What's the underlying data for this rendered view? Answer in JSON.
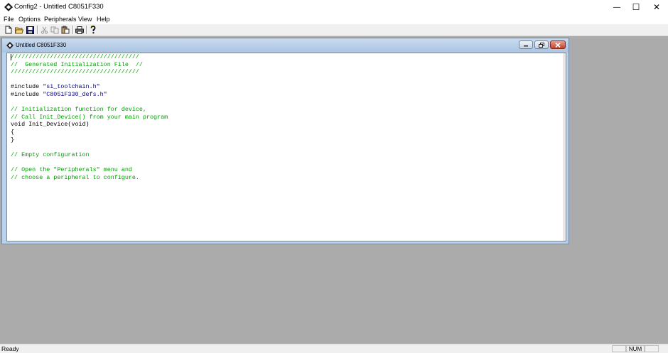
{
  "window": {
    "title": "Config2 - Untitled C8051F330",
    "controls": {
      "minimize": "—",
      "maximize": "☐",
      "close": "✕"
    }
  },
  "menu": [
    "File",
    "Options",
    "Peripherals",
    "View",
    "Help"
  ],
  "toolbar": {
    "buttons": [
      "new-file-icon",
      "open-folder-icon",
      "save-icon",
      "cut-icon",
      "copy-icon",
      "paste-icon",
      "print-icon",
      "help-icon"
    ]
  },
  "document": {
    "title": "Untitled C8051F330",
    "code_lines": [
      [
        {
          "t": "////////////////////////////////////",
          "c": "com"
        }
      ],
      [
        {
          "t": "//  Generated Initialization File  //",
          "c": "com"
        }
      ],
      [
        {
          "t": "////////////////////////////////////",
          "c": "com"
        }
      ],
      [],
      [
        {
          "t": "#include ",
          "c": "txt"
        },
        {
          "t": "\"si_toolchain.h\"",
          "c": "str"
        }
      ],
      [
        {
          "t": "#include ",
          "c": "txt"
        },
        {
          "t": "\"C8051F330_defs.h\"",
          "c": "str"
        }
      ],
      [],
      [
        {
          "t": "// Initialization function for device,",
          "c": "com"
        }
      ],
      [
        {
          "t": "// Call Init_Device() from your main program",
          "c": "com"
        }
      ],
      [
        {
          "t": "void Init_Device(void)",
          "c": "txt"
        }
      ],
      [
        {
          "t": "{",
          "c": "txt"
        }
      ],
      [
        {
          "t": "}",
          "c": "txt"
        }
      ],
      [],
      [
        {
          "t": "// Empty configuration",
          "c": "com"
        }
      ],
      [],
      [
        {
          "t": "// Open the \"Peripherals\" menu and",
          "c": "com"
        }
      ],
      [
        {
          "t": "// choose a peripheral to configure.",
          "c": "com"
        }
      ]
    ]
  },
  "status": {
    "text": "Ready",
    "panes": [
      "",
      "NUM",
      ""
    ]
  }
}
